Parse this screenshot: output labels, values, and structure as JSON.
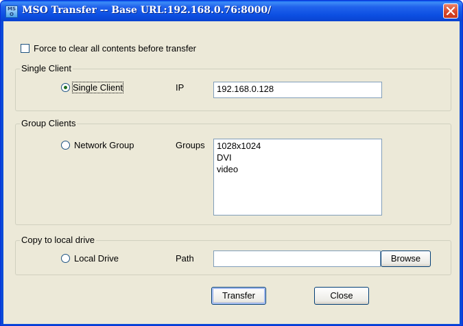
{
  "window": {
    "title": "MSO Transfer -- Base URL:192.168.0.76:8000/",
    "app_icon_text": "MS\nO"
  },
  "options": {
    "force_clear_label": "Force to clear all contents before transfer",
    "force_clear_checked": false
  },
  "single_client_group": {
    "legend": "Single Client",
    "radio_label": "Single Client",
    "radio_checked": true,
    "ip_label": "IP",
    "ip_value": "192.168.0.128"
  },
  "group_clients_group": {
    "legend": "Group Clients",
    "radio_label": "Network Group",
    "radio_checked": false,
    "groups_label": "Groups",
    "groups": [
      "1028x1024",
      "DVI",
      "video"
    ]
  },
  "local_drive_group": {
    "legend": "Copy to local drive",
    "radio_label": "Local Drive",
    "radio_checked": false,
    "path_label": "Path",
    "path_value": "",
    "browse_label": "Browse"
  },
  "buttons": {
    "transfer_label": "Transfer",
    "close_label": "Close"
  },
  "colors": {
    "titlebar": "#0c4fe2",
    "dialog_bg": "#ece9d8",
    "close_button": "#d8492a"
  }
}
